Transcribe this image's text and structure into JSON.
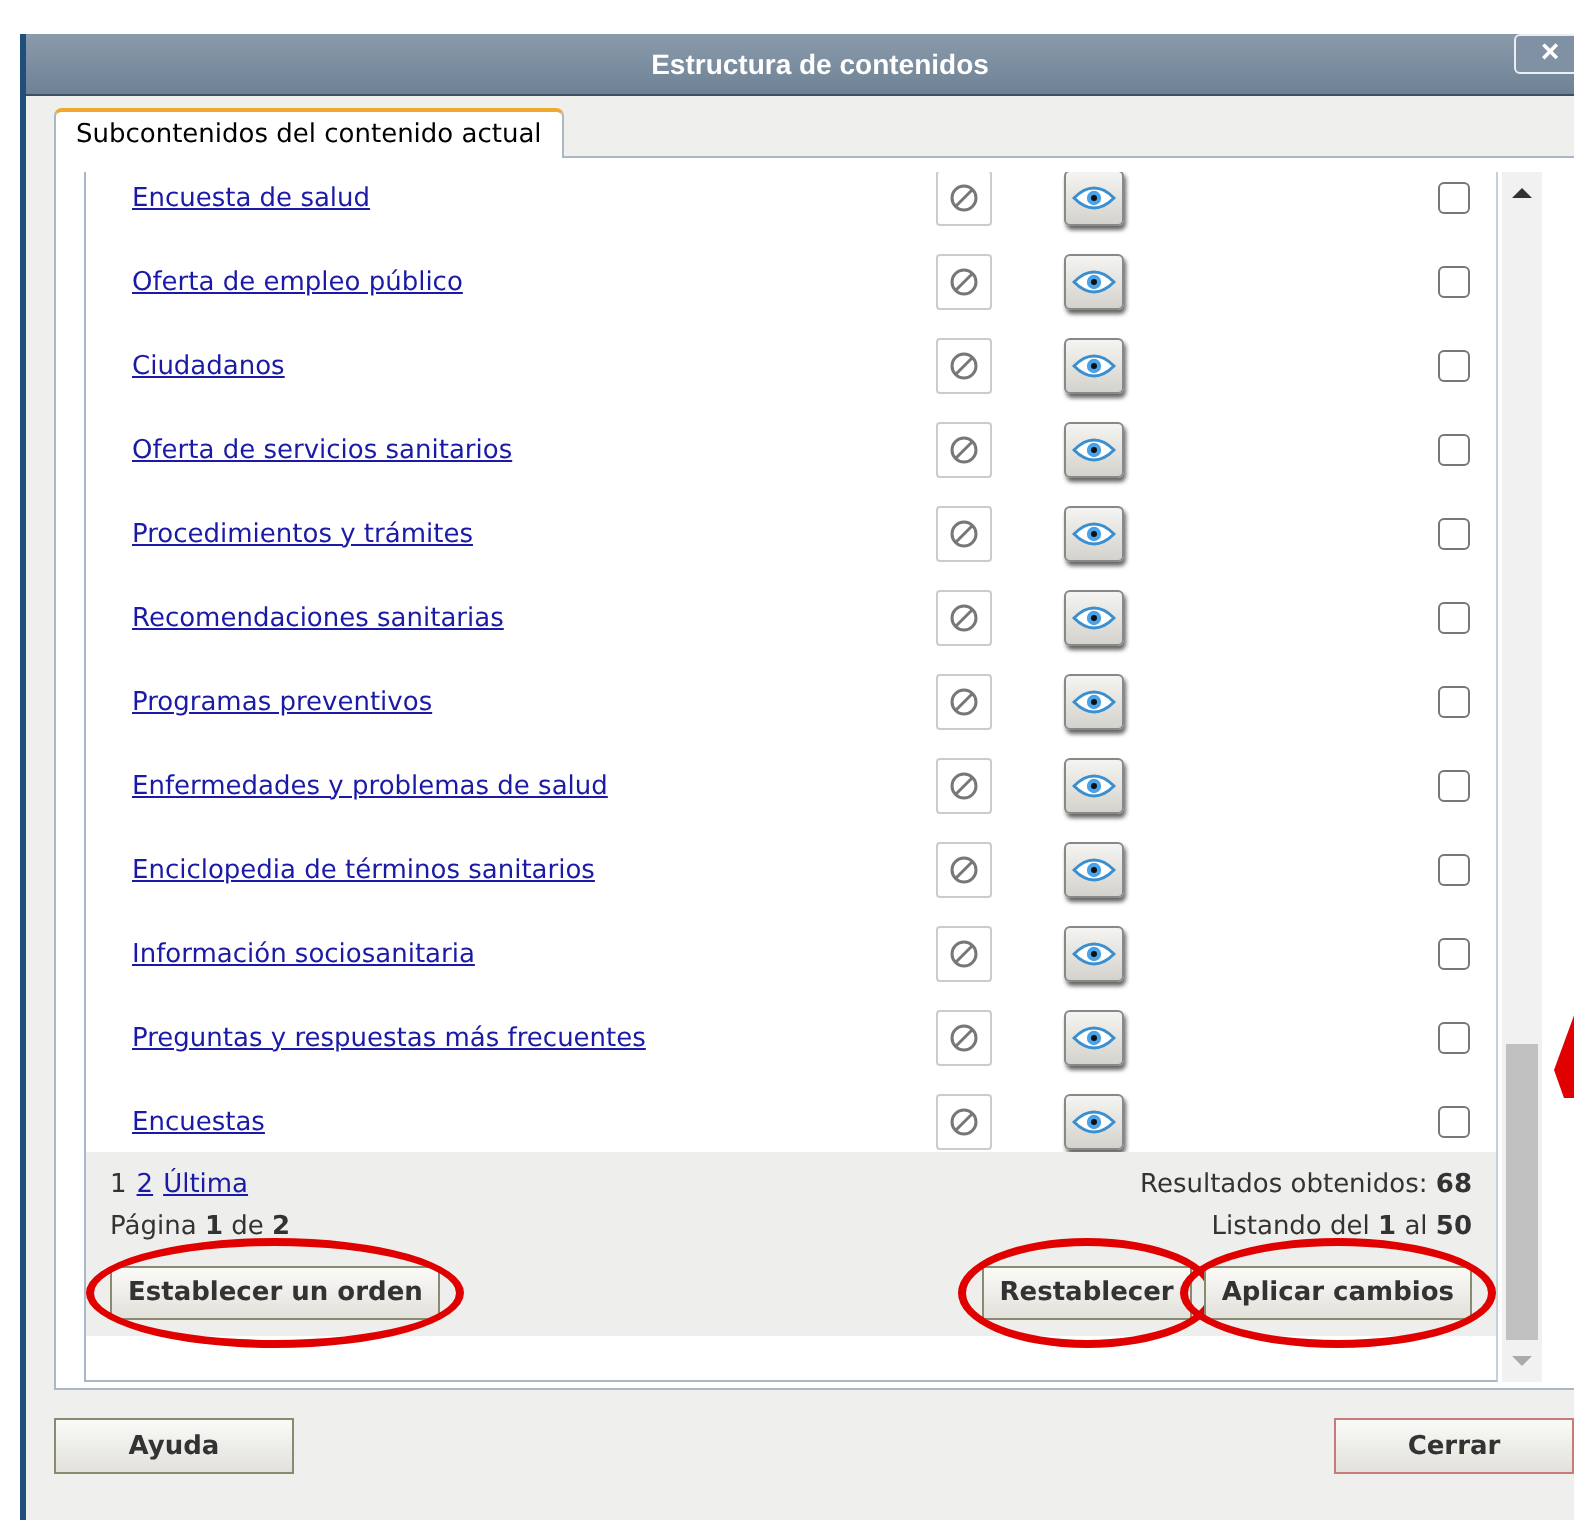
{
  "window": {
    "title": "Estructura de contenidos",
    "close": "×"
  },
  "tabs": [
    {
      "label": "Subcontenidos del contenido actual",
      "selected": true
    }
  ],
  "rows": [
    {
      "label": "Encuesta de salud",
      "checked": false
    },
    {
      "label": "Oferta de empleo público",
      "checked": false
    },
    {
      "label": "Ciudadanos",
      "checked": false
    },
    {
      "label": "Oferta de servicios sanitarios",
      "checked": false
    },
    {
      "label": "Procedimientos y trámites",
      "checked": false
    },
    {
      "label": "Recomendaciones sanitarias",
      "checked": false
    },
    {
      "label": "Programas preventivos",
      "checked": false
    },
    {
      "label": "Enfermedades y problemas de salud",
      "checked": false
    },
    {
      "label": "Enciclopedia de términos sanitarios",
      "checked": false
    },
    {
      "label": "Información sociosanitaria",
      "checked": false
    },
    {
      "label": "Preguntas y respuestas más frecuentes",
      "checked": false
    },
    {
      "label": "Encuestas",
      "checked": false
    }
  ],
  "pagination": {
    "pages": [
      {
        "label": "1",
        "selected": true
      },
      {
        "label": "2",
        "selected": false
      },
      {
        "label": "Última",
        "selected": false
      }
    ],
    "page_info": "Página **1** de **2**",
    "results": "Resultados obtenidos: **68**",
    "listing": "Listando del **1** al **50**"
  },
  "list_buttons": [
    {
      "label": "Establecer un orden",
      "circled": true,
      "kind": "left"
    },
    {
      "label": "Restablecer",
      "circled": true,
      "kind": "right"
    },
    {
      "label": "Aplicar cambios",
      "circled": true,
      "kind": "right"
    }
  ],
  "footer_buttons": [
    {
      "label": "Ayuda",
      "kind": "help"
    },
    {
      "label": "Cerrar",
      "kind": "close"
    }
  ],
  "annotations": [
    {
      "kind": "arrow"
    }
  ]
}
